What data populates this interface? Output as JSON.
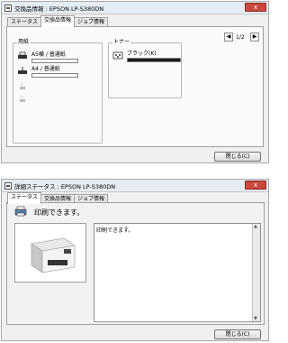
{
  "window1": {
    "title": "交換品情報 : EPSON LP-S380DN",
    "close": "x",
    "tabs": [
      "ステータス",
      "交換品情報",
      "ジョブ情報"
    ],
    "active_tab": "交換品情報",
    "pagination": {
      "prev": "◀",
      "page": "1/2",
      "next": "▶"
    },
    "paper_group": {
      "label": "用紙",
      "trays": [
        {
          "label": "A5横 / 普通紙",
          "icon": "tray-icon"
        },
        {
          "label": "A4 / 普通紙",
          "icon": "tray-icon"
        },
        {
          "label": "",
          "icon": "tray-icon-disabled"
        },
        {
          "label": "",
          "icon": "tray-icon-disabled"
        }
      ]
    },
    "toner_group": {
      "label": "トナー",
      "items": [
        {
          "label": "ブラック(K)",
          "level": 1.0,
          "icon": "toner-icon"
        }
      ]
    },
    "close_button": "閉じる(C)"
  },
  "window2": {
    "title": "詳細ステータス : EPSON LP-S380DN",
    "close": "x",
    "tabs": [
      "ステータス",
      "交換品情報",
      "ジョブ情報"
    ],
    "active_tab": "ステータス",
    "status_message": "印刷できます。",
    "detail_text": "印刷できます。",
    "close_button": "閉じる(C)"
  }
}
